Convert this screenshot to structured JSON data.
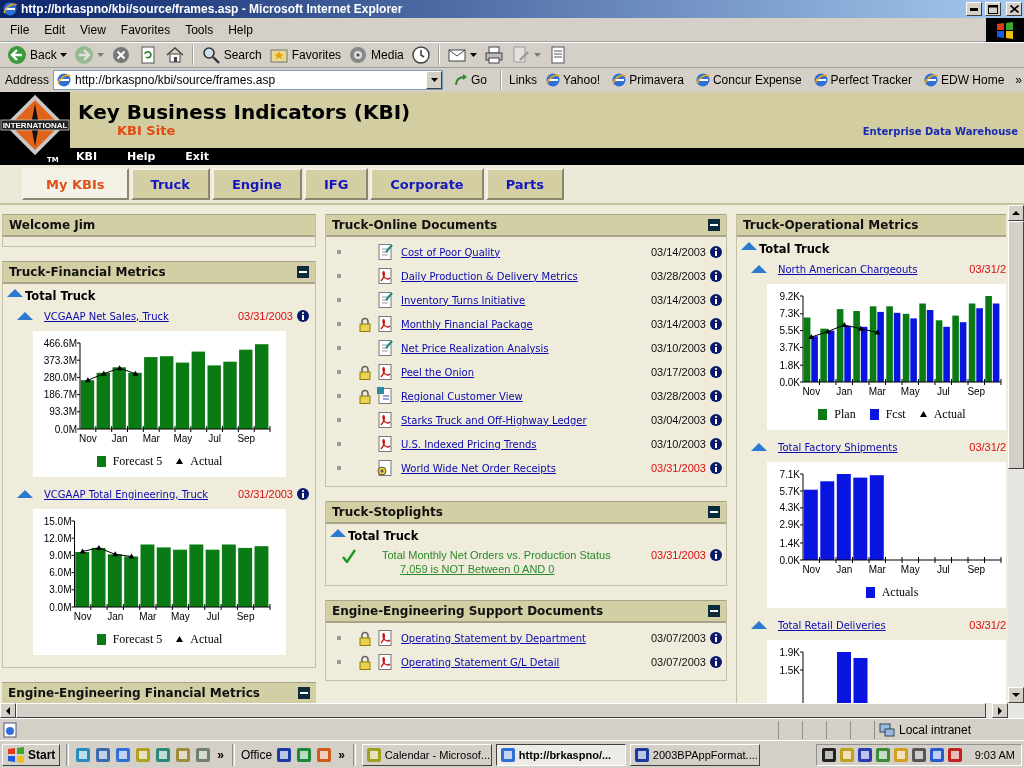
{
  "window": {
    "title": "http://brkaspno/kbi/source/frames.asp - Microsoft Internet Explorer"
  },
  "menu": [
    "File",
    "Edit",
    "View",
    "Favorites",
    "Tools",
    "Help"
  ],
  "toolbar": [
    [
      {
        "kind": "back",
        "label": "Back",
        "dropdown": true,
        "disabled": false
      },
      {
        "kind": "forward",
        "dropdown": true,
        "disabled": true
      },
      {
        "kind": "stop",
        "disabled": false
      },
      {
        "kind": "refresh",
        "disabled": false
      },
      {
        "kind": "home",
        "disabled": false
      }
    ],
    [
      {
        "kind": "search",
        "label": "Search",
        "disabled": false
      },
      {
        "kind": "favorites",
        "label": "Favorites",
        "disabled": false
      },
      {
        "kind": "media",
        "label": "Media",
        "disabled": false
      },
      {
        "kind": "history",
        "disabled": false
      }
    ],
    [
      {
        "kind": "mail",
        "dropdown": true,
        "disabled": false
      },
      {
        "kind": "print",
        "disabled": false
      },
      {
        "kind": "edit",
        "dropdown": true,
        "disabled": true
      },
      {
        "kind": "discuss",
        "disabled": false
      }
    ]
  ],
  "address": {
    "label": "Address",
    "value": "http://brkaspno/kbi/source/frames.asp",
    "go": "Go"
  },
  "links": {
    "label": "Links",
    "items": [
      "Yahoo!",
      "Primavera",
      "Concur Expense",
      "Perfect Tracker",
      "EDW Home"
    ],
    "more": "»"
  },
  "header": {
    "logo": {
      "name": "INTERNATIONAL",
      "mark": "TM"
    },
    "title": "Key Business Indicators (KBI)",
    "subtitle": "KBI Site",
    "note": "Enterprise Data Warehouse",
    "nav": [
      "KBI",
      "Help",
      "Exit"
    ]
  },
  "tabs": [
    {
      "label": "My KBIs",
      "selected": true
    },
    {
      "label": "Truck",
      "selected": false
    },
    {
      "label": "Engine",
      "selected": false
    },
    {
      "label": "IFG",
      "selected": false
    },
    {
      "label": "Corporate",
      "selected": false
    },
    {
      "label": "Parts",
      "selected": false
    }
  ],
  "columns": [
    {
      "panels": [
        {
          "kind": "welcome",
          "title": "Welcome Jim",
          "collapsible": false
        },
        {
          "kind": "metrics",
          "title": "Truck-Financial Metrics",
          "collapsible": true,
          "group": {
            "title": "Total Truck",
            "expanded": true
          },
          "items": [
            {
              "title": "VCGAAP Net Sales, Truck",
              "date": "03/31/2003",
              "date_alert": true,
              "expanded": true,
              "chart_data": {
                "type": "bar",
                "ylim": [
                  0,
                  466.6
                ],
                "yticks": [
                  {
                    "value": 0,
                    "label": "0.0M"
                  },
                  {
                    "value": 93.3,
                    "label": "93.3M"
                  },
                  {
                    "value": 186.7,
                    "label": "186.7M"
                  },
                  {
                    "value": 280,
                    "label": "280.0M"
                  },
                  {
                    "value": 373.3,
                    "label": "373.3M"
                  },
                  {
                    "value": 466.6,
                    "label": "466.6M"
                  }
                ],
                "categories": [
                  "Nov",
                  null,
                  "Jan",
                  null,
                  "Mar",
                  null,
                  "May",
                  null,
                  "Jul",
                  null,
                  "Sep",
                  null
                ],
                "series": [
                  {
                    "name": "Forecast 5",
                    "type": "bar",
                    "color": "#0a7a14",
                    "values": [
                      265,
                      305,
                      335,
                      305,
                      390,
                      395,
                      360,
                      420,
                      345,
                      365,
                      430,
                      460
                    ]
                  },
                  {
                    "name": "Actual",
                    "type": "line",
                    "marker": "triangle",
                    "color": "#000000",
                    "values": [
                      265,
                      300,
                      330,
                      300,
                      null,
                      null,
                      null,
                      null,
                      null,
                      null,
                      null,
                      null
                    ]
                  }
                ],
                "legend": "bottom"
              }
            },
            {
              "title": "VCGAAP Total Engineering, Truck",
              "date": "03/31/2003",
              "date_alert": true,
              "expanded": true,
              "chart_data": {
                "type": "bar",
                "ylim": [
                  0,
                  15
                ],
                "yticks": [
                  {
                    "value": 0,
                    "label": "0.0M"
                  },
                  {
                    "value": 3,
                    "label": "3.0M"
                  },
                  {
                    "value": 6,
                    "label": "6.0M"
                  },
                  {
                    "value": 9,
                    "label": "9.0M"
                  },
                  {
                    "value": 12,
                    "label": "12.0M"
                  },
                  {
                    "value": 15,
                    "label": "15.0M"
                  }
                ],
                "categories": [
                  "Nov",
                  null,
                  "Jan",
                  null,
                  "Mar",
                  null,
                  "May",
                  null,
                  "Jul",
                  null,
                  "Sep",
                  null
                ],
                "series": [
                  {
                    "name": "Forecast 5",
                    "type": "bar",
                    "color": "#0a7a14",
                    "values": [
                      9.6,
                      10.3,
                      9.2,
                      8.8,
                      10.9,
                      10.4,
                      10.0,
                      10.9,
                      10.0,
                      10.9,
                      10.3,
                      10.6
                    ]
                  },
                  {
                    "name": "Actual",
                    "type": "line",
                    "marker": "triangle",
                    "color": "#000000",
                    "values": [
                      9.7,
                      10.3,
                      9.2,
                      8.8,
                      null,
                      null,
                      null,
                      null,
                      null,
                      null,
                      null,
                      null
                    ]
                  }
                ],
                "legend": "bottom"
              }
            }
          ]
        },
        {
          "kind": "metrics",
          "title": "Engine-Engineering Financial Metrics",
          "collapsible": true
        }
      ]
    },
    {
      "panels": [
        {
          "kind": "documents",
          "title": "Truck-Online Documents",
          "collapsible": true,
          "items": [
            {
              "title": "Cost of Poor Quality",
              "date": "03/14/2003",
              "date_alert": false,
              "locked": false,
              "kind": "report"
            },
            {
              "title": "Daily Production & Delivery Metrics",
              "date": "03/28/2003",
              "date_alert": false,
              "locked": false,
              "kind": "pdf"
            },
            {
              "title": "Inventory Turns Initiative",
              "date": "03/14/2003",
              "date_alert": false,
              "locked": false,
              "kind": "report"
            },
            {
              "title": "Monthly Financial Package",
              "date": "03/14/2003",
              "date_alert": false,
              "locked": true,
              "kind": "pdf"
            },
            {
              "title": "Net Price Realization Analysis",
              "date": "03/10/2003",
              "date_alert": false,
              "locked": false,
              "kind": "report"
            },
            {
              "title": "Peel the Onion",
              "date": "03/17/2003",
              "date_alert": false,
              "locked": true,
              "kind": "pdf"
            },
            {
              "title": "Regional Customer View",
              "date": "03/28/2003",
              "date_alert": false,
              "locked": true,
              "kind": "data"
            },
            {
              "title": "Starks Truck and Off-Highway Ledger",
              "date": "03/04/2003",
              "date_alert": false,
              "locked": false,
              "kind": "pdf"
            },
            {
              "title": "U.S. Indexed Pricing Trends",
              "date": "03/10/2003",
              "date_alert": false,
              "locked": false,
              "kind": "pdf"
            },
            {
              "title": "World Wide Net Order Receipts",
              "date": "03/31/2003",
              "date_alert": true,
              "locked": false,
              "kind": "app"
            }
          ]
        },
        {
          "kind": "stoplights",
          "title": "Truck-Stoplights",
          "collapsible": true,
          "group": {
            "title": "Total Truck",
            "expanded": true
          },
          "items": [
            {
              "kind": "ok",
              "title": "Total Monthly Net Orders vs. Production Status",
              "detail": "7,059 is NOT Between 0 AND 0",
              "date": "03/31/2003",
              "date_alert": true
            }
          ]
        },
        {
          "kind": "documents",
          "title": "Engine-Engineering Support Documents",
          "collapsible": true,
          "items": [
            {
              "title": "Operating Statement by Department",
              "date": "03/07/2003",
              "date_alert": false,
              "locked": true,
              "kind": "pdf"
            },
            {
              "title": "Operating Statement G/L Detail",
              "date": "03/07/2003",
              "date_alert": false,
              "locked": true,
              "kind": "pdf"
            }
          ]
        }
      ]
    },
    {
      "panels": [
        {
          "kind": "metrics",
          "title": "Truck-Operational Metrics",
          "collapsible": false,
          "group": {
            "title": "Total Truck",
            "expanded": true
          },
          "items": [
            {
              "title": "North American Chargeouts",
              "date": "03/31/2",
              "date_alert": true,
              "expanded": true,
              "chart_data": {
                "type": "bar",
                "ylim": [
                  0,
                  9.2
                ],
                "yticks": [
                  {
                    "value": 0,
                    "label": "0.0K"
                  },
                  {
                    "value": 1.8,
                    "label": "1.8K"
                  },
                  {
                    "value": 3.7,
                    "label": "3.7K"
                  },
                  {
                    "value": 5.5,
                    "label": "5.5K"
                  },
                  {
                    "value": 7.3,
                    "label": "7.3K"
                  },
                  {
                    "value": 9.2,
                    "label": "9.2K"
                  }
                ],
                "categories": [
                  "Nov",
                  null,
                  "Jan",
                  null,
                  "Mar",
                  null,
                  "May",
                  null,
                  "Jul",
                  null,
                  "Sep",
                  null
                ],
                "series": [
                  {
                    "name": "Plan",
                    "type": "bar",
                    "color": "#0a7a14",
                    "values": [
                      6.9,
                      5.7,
                      7.8,
                      7.6,
                      8.1,
                      8.1,
                      7.3,
                      8.4,
                      6.6,
                      7.1,
                      8.4,
                      9.2
                    ]
                  },
                  {
                    "name": "Fcst",
                    "type": "bar",
                    "color": "#0a14e0",
                    "values": [
                      4.9,
                      5.5,
                      6.0,
                      5.9,
                      7.5,
                      7.4,
                      6.8,
                      7.7,
                      5.9,
                      6.4,
                      7.9,
                      8.4
                    ]
                  },
                  {
                    "name": "Actual",
                    "type": "line",
                    "marker": "triangle",
                    "color": "#000000",
                    "values": [
                      4.8,
                      5.4,
                      6.1,
                      5.7,
                      5.3,
                      null,
                      null,
                      null,
                      null,
                      null,
                      null,
                      null
                    ]
                  }
                ],
                "legend": "bottom"
              }
            },
            {
              "title": "Total Factory Shipments",
              "date": "03/31/2",
              "date_alert": true,
              "expanded": true,
              "chart_data": {
                "type": "bar",
                "ylim": [
                  0,
                  7.1
                ],
                "yticks": [
                  {
                    "value": 0,
                    "label": "0.0K"
                  },
                  {
                    "value": 1.4,
                    "label": "1.4K"
                  },
                  {
                    "value": 2.9,
                    "label": "2.9K"
                  },
                  {
                    "value": 4.3,
                    "label": "4.3K"
                  },
                  {
                    "value": 5.7,
                    "label": "5.7K"
                  },
                  {
                    "value": 7.1,
                    "label": "7.1K"
                  }
                ],
                "categories": [
                  "Nov",
                  null,
                  "Jan",
                  null,
                  "Mar",
                  null,
                  "May",
                  null,
                  "Jul",
                  null,
                  "Sep",
                  null
                ],
                "series": [
                  {
                    "name": "Actuals",
                    "type": "bar",
                    "color": "#0a14e0",
                    "values": [
                      5.8,
                      6.5,
                      7.1,
                      6.8,
                      7.0,
                      null,
                      null,
                      null,
                      null,
                      null,
                      null,
                      null
                    ]
                  }
                ],
                "legend": "bottom"
              }
            },
            {
              "title": "Total Retail Deliveries",
              "date": "03/31/2",
              "date_alert": true,
              "expanded": true,
              "axis_labels": [
                "1.9K",
                "1.5K"
              ]
            }
          ]
        }
      ]
    }
  ],
  "status_bar": {
    "zone": "Local intranet"
  },
  "taskbar": {
    "start": "Start",
    "quick_launch_more": "»",
    "toolbar_label": "Office",
    "toolbar_more": "»",
    "tasks": [
      {
        "label": "Calendar - Microsof...",
        "selected": false
      },
      {
        "label": "http://brkaspno/...",
        "selected": true
      },
      {
        "label": "2003BPAppFormat....",
        "selected": false
      }
    ],
    "clock": "9:03 AM"
  }
}
